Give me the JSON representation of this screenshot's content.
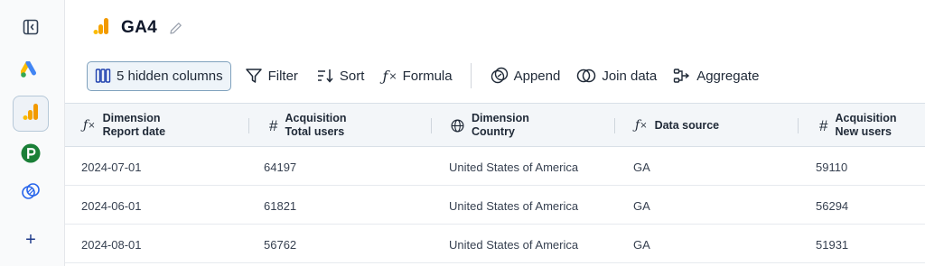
{
  "sidebar": {
    "items": [
      {
        "name": "collapse-sidebar",
        "icon": "panel-left-icon"
      },
      {
        "name": "google-ads",
        "icon": "google-ads-icon"
      },
      {
        "name": "ga4",
        "icon": "analytics-bars-icon",
        "active": true
      },
      {
        "name": "pipedrive",
        "icon": "pipedrive-p-icon"
      },
      {
        "name": "join",
        "icon": "link-circles-icon"
      },
      {
        "name": "add",
        "icon": "plus-icon",
        "label": "+"
      }
    ]
  },
  "header": {
    "title": "GA4"
  },
  "toolbar": {
    "hidden_columns": "5 hidden columns",
    "filter": "Filter",
    "sort": "Sort",
    "formula": "Formula",
    "append": "Append",
    "join": "Join data",
    "aggregate": "Aggregate"
  },
  "table": {
    "columns": [
      {
        "line1": "Dimension",
        "line2": "Report date",
        "icon": "formula-icon"
      },
      {
        "line1": "Acquisition",
        "line2": "Total users",
        "icon": "hash-icon"
      },
      {
        "line1": "Dimension",
        "line2": "Country",
        "icon": "globe-icon"
      },
      {
        "line1": "Data source",
        "line2": "",
        "icon": "formula-icon"
      },
      {
        "line1": "Acquisition",
        "line2": "New users",
        "icon": "hash-icon"
      }
    ],
    "rows": [
      [
        "2024-07-01",
        "64197",
        "United States of America",
        "GA",
        "59110"
      ],
      [
        "2024-06-01",
        "61821",
        "United States of America",
        "GA",
        "56294"
      ],
      [
        "2024-08-01",
        "56762",
        "United States of America",
        "GA",
        "51931"
      ]
    ]
  },
  "colors": {
    "accent_border": "#7fa1bd",
    "ga_orange": "#f29900",
    "ga_yellow": "#fbbc04",
    "pipedrive_green": "#1a7f37",
    "ads_blue": "#4285f4"
  }
}
